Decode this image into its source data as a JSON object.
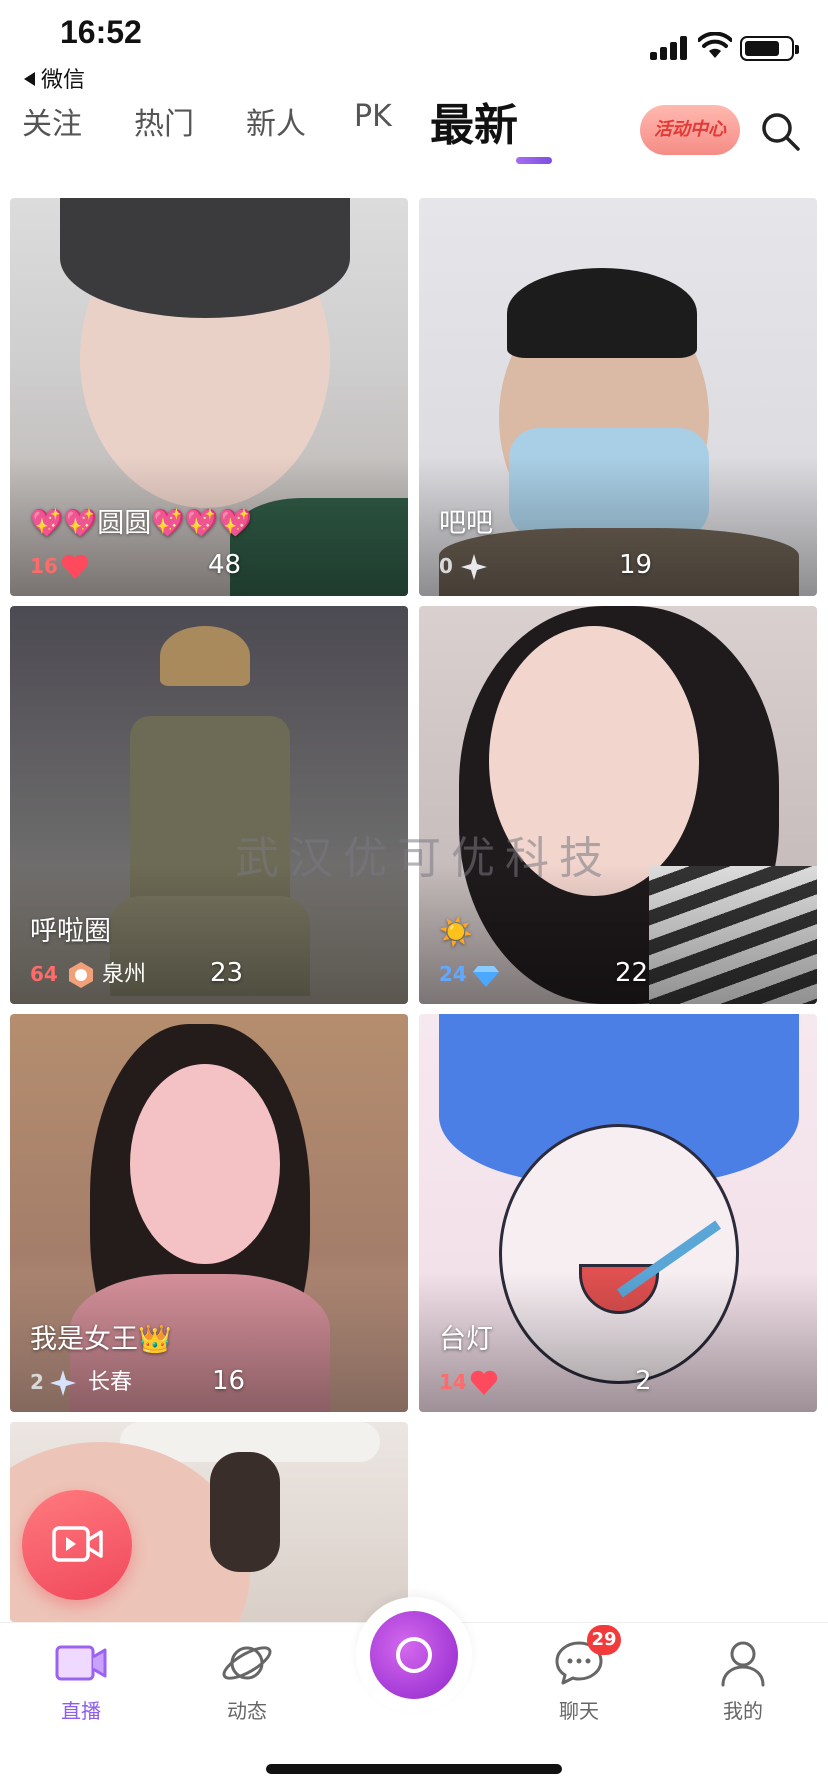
{
  "status_bar": {
    "time": "16:52",
    "back_app": "微信"
  },
  "tabs": [
    {
      "label": "关注"
    },
    {
      "label": "热门"
    },
    {
      "label": "新人"
    },
    {
      "label": "PK"
    },
    {
      "label": "最新",
      "active": true
    }
  ],
  "activity_button": "活动中心",
  "watermark": "武汉优可优科技",
  "streams": [
    {
      "name": "💖💖圆圆💖💖💖",
      "level": "16",
      "badge": "heart-badge-icon",
      "city": "",
      "viewers": "48"
    },
    {
      "name": "吧吧",
      "level": "0",
      "badge": "sparkle-badge-icon",
      "city": "",
      "viewers": "19"
    },
    {
      "name": "呼啦圈",
      "level": "64",
      "badge": "emblem-badge-icon",
      "city": "泉州",
      "viewers": "23"
    },
    {
      "name": "☀️",
      "level": "24",
      "badge": "diamond-badge-icon",
      "city": "",
      "viewers": "22"
    },
    {
      "name": "我是女王👑",
      "level": "2",
      "badge": "sparkle-badge-icon",
      "city": "长春",
      "viewers": "16"
    },
    {
      "name": "台灯",
      "level": "14",
      "badge": "heart-badge-icon",
      "city": "",
      "viewers": "2"
    },
    {
      "name": "",
      "level": "",
      "badge": "",
      "city": "",
      "viewers": ""
    }
  ],
  "bottom_nav": [
    {
      "label": "直播",
      "icon": "live-video-icon",
      "active": true
    },
    {
      "label": "动态",
      "icon": "planet-icon"
    },
    {
      "label": "",
      "icon": "camera-record-icon"
    },
    {
      "label": "聊天",
      "icon": "chat-bubble-icon",
      "badge": "29"
    },
    {
      "label": "我的",
      "icon": "profile-icon"
    }
  ],
  "colors": {
    "accent": "#8d5cf0",
    "badge_red": "#f23a3a",
    "record_button": "#f0485c"
  }
}
